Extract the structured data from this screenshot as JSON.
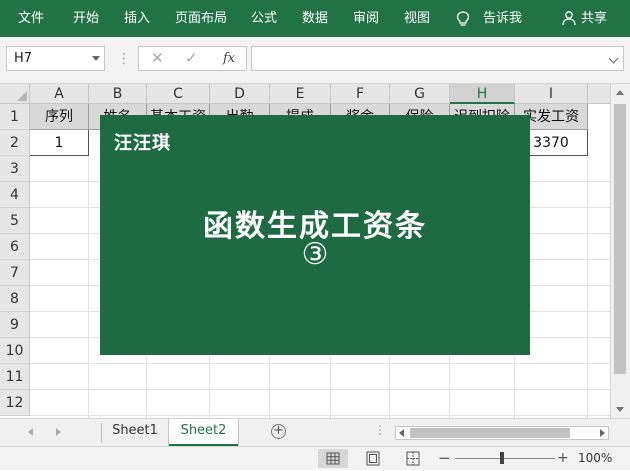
{
  "ribbon": {
    "tabs": [
      "文件",
      "开始",
      "插入",
      "页面布局",
      "公式",
      "数据",
      "审阅",
      "视图"
    ],
    "tell_me": "告诉我",
    "share": "共享",
    "accent": "#217346"
  },
  "formula_bar": {
    "name_box": "H7",
    "fx": "fx",
    "formula": ""
  },
  "sheet": {
    "columns": [
      "A",
      "B",
      "C",
      "D",
      "E",
      "F",
      "G",
      "H",
      "I"
    ],
    "selected_column": "H",
    "rows": [
      "1",
      "2",
      "3",
      "4",
      "5",
      "6",
      "7",
      "8",
      "9",
      "10",
      "11",
      "12"
    ],
    "header_cells": [
      "序列",
      "姓名",
      "基本工资",
      "出勤",
      "提成",
      "奖金",
      "保险",
      "迟到扣除",
      "实发工资"
    ],
    "row2_a": "1",
    "row2_i": "3370"
  },
  "overlay": {
    "brand": "汪汪琪",
    "title": "函数生成工资条",
    "number": "③",
    "color": "#1e6b42"
  },
  "tabs": {
    "sheets": [
      "Sheet1",
      "Sheet2"
    ],
    "active": "Sheet2"
  },
  "status": {
    "zoom": "100%",
    "zoom_minus": "−",
    "zoom_plus": "+"
  }
}
